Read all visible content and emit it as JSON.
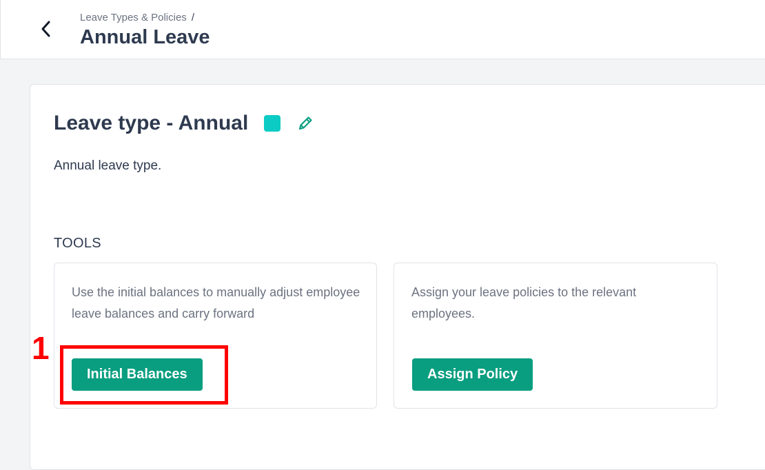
{
  "header": {
    "back_icon": "chevron-left-icon",
    "breadcrumb": {
      "parent": "Leave Types & Policies",
      "separator": "/"
    },
    "title": "Annual Leave"
  },
  "leave_type": {
    "title": "Leave type - Annual",
    "color": "#0ccbc5",
    "edit_icon": "pencil-icon",
    "description": "Annual leave type."
  },
  "tools": {
    "heading": "TOOLS",
    "items": [
      {
        "description": "Use the initial balances to manually adjust employee leave balances and carry forward",
        "button_label": "Initial Balances"
      },
      {
        "description": "Assign your leave policies to the relevant employees.",
        "button_label": "Assign Policy"
      }
    ]
  },
  "annotation": {
    "label": "1",
    "color": "#ff0000"
  },
  "colors": {
    "accent": "#0a9e80",
    "text": "#2e3a4f",
    "muted": "#6b7280"
  }
}
